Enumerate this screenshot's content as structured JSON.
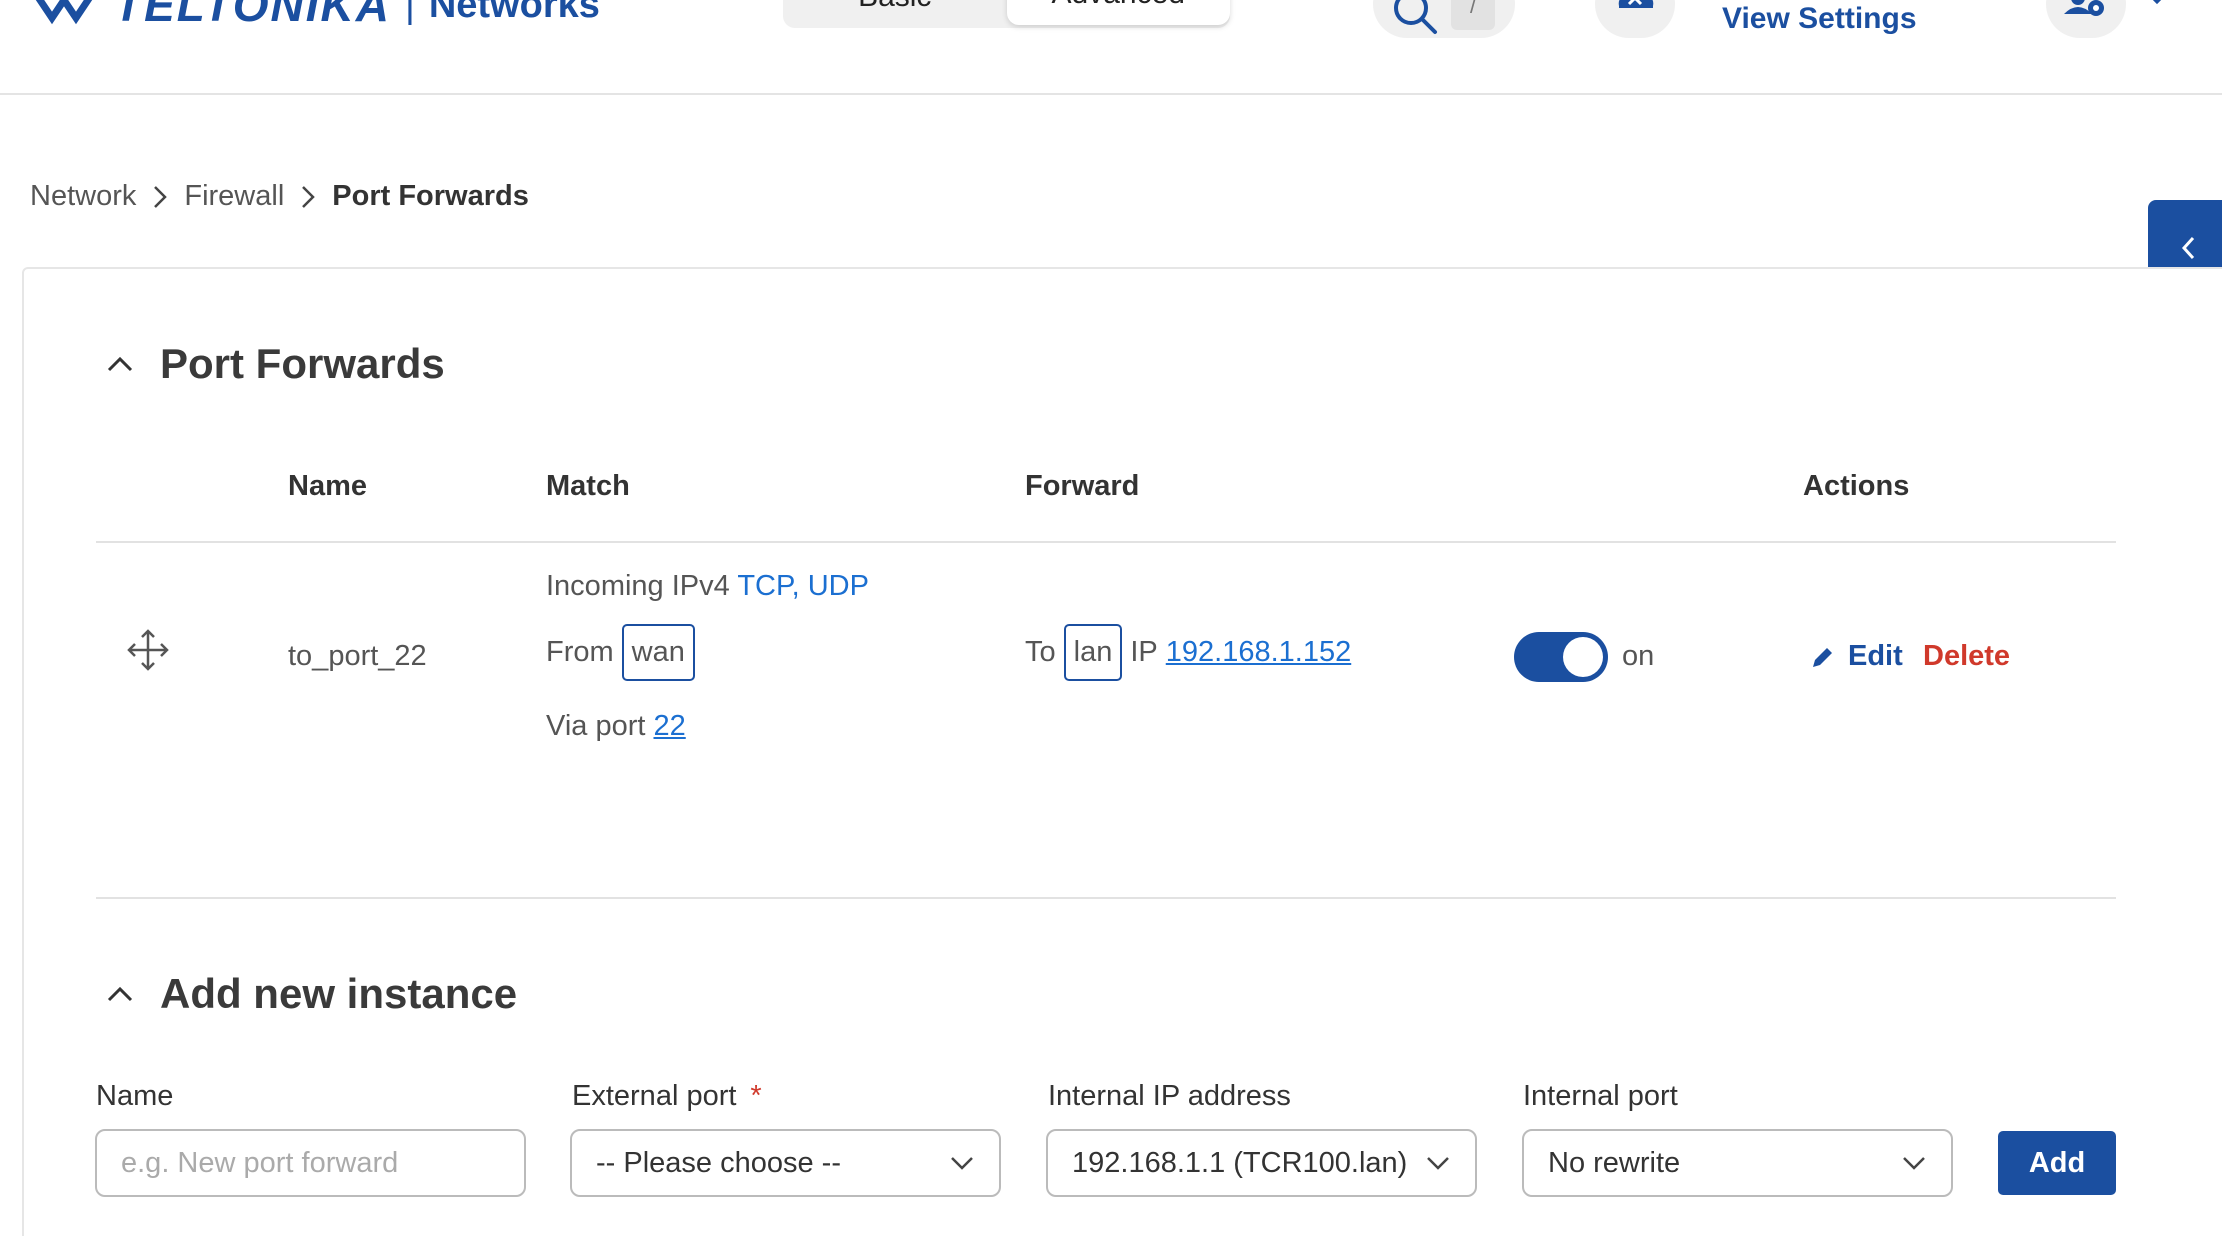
{
  "header": {
    "brand": "TELTONIKA",
    "brand_separator": "|",
    "brand_sub": "Networks",
    "mode_basic": "Basic",
    "mode_advanced": "Advanced",
    "search_shortcut": "/",
    "view_settings": "View Settings"
  },
  "breadcrumb": {
    "items": [
      "Network",
      "Firewall",
      "Port Forwards"
    ]
  },
  "port_forwards": {
    "title": "Port Forwards",
    "columns": {
      "name": "Name",
      "match": "Match",
      "forward": "Forward",
      "actions": "Actions"
    },
    "rows": [
      {
        "name": "to_port_22",
        "match_incoming": "Incoming IPv4",
        "match_proto_tcp": "TCP",
        "match_proto_sep": ",",
        "match_proto_udp": "UDP",
        "match_from_label": "From",
        "match_from_zone": "wan",
        "match_via_label": "Via port",
        "match_via_port": "22",
        "forward_to_label": "To",
        "forward_zone": "lan",
        "forward_ip_label": "IP",
        "forward_ip": "192.168.1.152",
        "enabled": true,
        "status_label": "on",
        "edit_label": "Edit",
        "delete_label": "Delete"
      }
    ]
  },
  "add_instance": {
    "title": "Add new instance",
    "name_label": "Name",
    "name_placeholder": "e.g. New port forward",
    "external_port_label": "External port",
    "required_mark": "*",
    "external_port_value": "-- Please choose --",
    "internal_ip_label": "Internal IP address",
    "internal_ip_value": "192.168.1.1 (TCR100.lan)",
    "internal_port_label": "Internal port",
    "internal_port_value": "No rewrite",
    "add_button": "Add"
  },
  "colors": {
    "brand_blue": "#1b4fa0",
    "link_blue": "#1b6fd1",
    "delete_red": "#d0392b"
  }
}
